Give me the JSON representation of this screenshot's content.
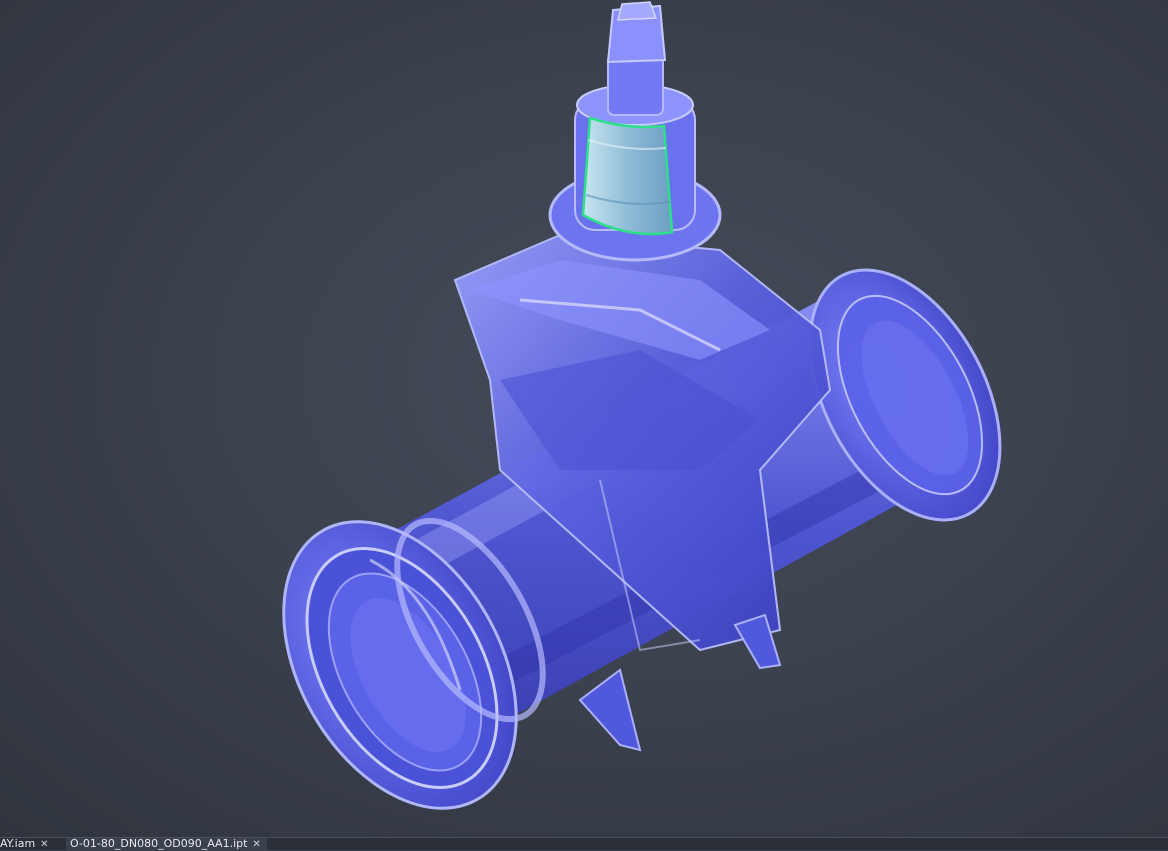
{
  "document_tabs": [
    {
      "label": "AY.iam",
      "close_icon": "close-icon"
    },
    {
      "label": "O-01-80_DN080_OD090_AA1.ipt",
      "close_icon": "close-icon"
    }
  ],
  "close_glyph": "✕",
  "colors": {
    "background": "#3c424e",
    "model_body": "#5a62e0",
    "selection_highlight": "#2de08a",
    "selected_face": "#9cc8de"
  }
}
